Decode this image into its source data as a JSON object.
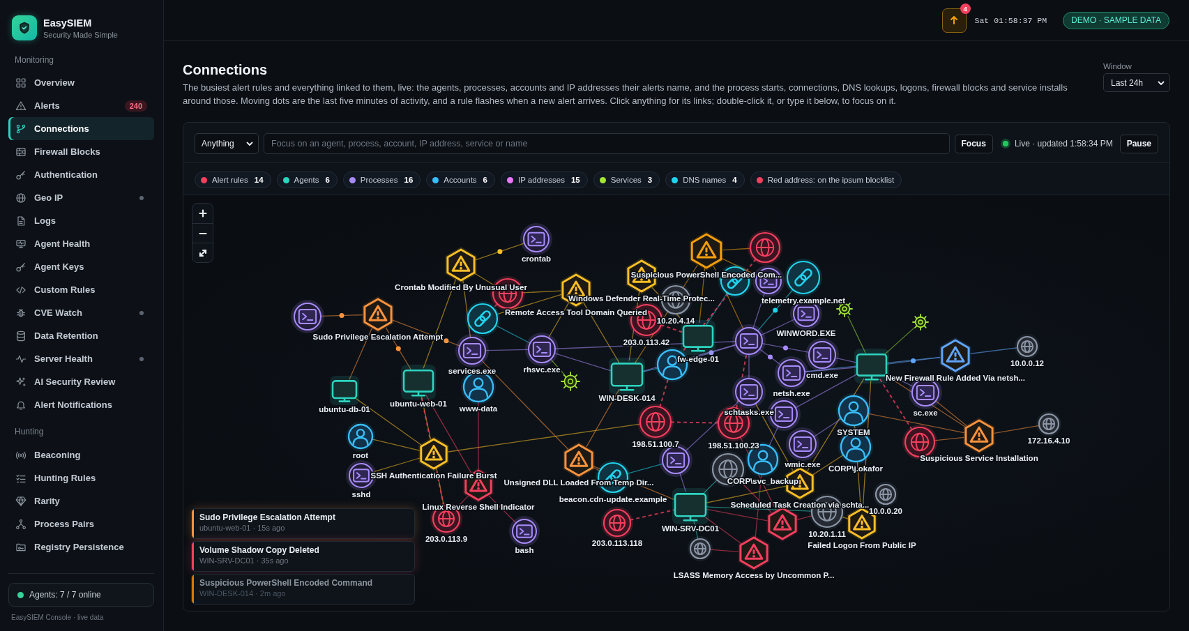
{
  "sidebar": {
    "brand": "EasySIEM",
    "tagline": "Security Made Simple",
    "sections": [
      {
        "title": "Monitoring",
        "items": [
          {
            "label": "Overview",
            "selected": false,
            "dot": false
          },
          {
            "label": "Alerts",
            "selected": false,
            "dot": false,
            "badge": "240"
          },
          {
            "label": "Connections",
            "selected": true,
            "dot": false
          },
          {
            "label": "Firewall Blocks",
            "selected": false,
            "dot": false
          },
          {
            "label": "Authentication",
            "selected": false,
            "dot": false
          },
          {
            "label": "Geo IP",
            "selected": false,
            "dot": true
          },
          {
            "label": "Logs",
            "selected": false,
            "dot": false
          },
          {
            "label": "Agent Health",
            "selected": false,
            "dot": false
          },
          {
            "label": "Agent Keys",
            "selected": false,
            "dot": false
          },
          {
            "label": "Custom Rules",
            "selected": false,
            "dot": false
          },
          {
            "label": "CVE Watch",
            "selected": false,
            "dot": true
          },
          {
            "label": "Data Retention",
            "selected": false,
            "dot": false
          },
          {
            "label": "Server Health",
            "selected": false,
            "dot": true
          },
          {
            "label": "AI Security Review",
            "selected": false,
            "dot": false
          },
          {
            "label": "Alert Notifications",
            "selected": false,
            "dot": false
          }
        ]
      },
      {
        "title": "Hunting",
        "items": [
          {
            "label": "Beaconing",
            "selected": false,
            "dot": false
          },
          {
            "label": "Hunting Rules",
            "selected": false,
            "dot": false
          },
          {
            "label": "Rarity",
            "selected": false,
            "dot": false
          },
          {
            "label": "Process Pairs",
            "selected": false,
            "dot": false
          },
          {
            "label": "Registry Persistence",
            "selected": false,
            "dot": false
          }
        ]
      }
    ],
    "agents_status": {
      "text": "Agents: 7 / 7 online",
      "online": true
    },
    "footer": "EasySIEM Console · live data"
  },
  "topbar": {
    "update_count": "4",
    "clock": "Sat 01:58:37 PM",
    "mode_badge": "DEMO · SAMPLE DATA"
  },
  "page": {
    "title": "Connections",
    "description": "The busiest alert rules and everything linked to them, live: the agents, processes, accounts and IP addresses their alerts name, and the process starts, connections, DNS lookups, logons, firewall blocks and service installs around those. Moving dots are the last five minutes of activity, and a rule flashes when a new alert arrives. Click anything for its links; double-click it, or type it below, to focus on it.",
    "window": {
      "label": "Window",
      "value": "Last 24h"
    }
  },
  "toolbar": {
    "filter": "Anything",
    "search": {
      "placeholder": "Focus on an agent, process, account, IP address, service or name"
    },
    "focus_button": "Focus",
    "live": {
      "on": true,
      "text": "Live · updated 1:58:34 PM"
    },
    "pause_button": "Pause"
  },
  "legend": [
    {
      "label": "Alert rules",
      "count": "14",
      "color": "#f43f5e"
    },
    {
      "label": "Agents",
      "count": "6",
      "color": "#2dd4bf"
    },
    {
      "label": "Processes",
      "count": "16",
      "color": "#a78bfa"
    },
    {
      "label": "Accounts",
      "count": "6",
      "color": "#38bdf8"
    },
    {
      "label": "IP addresses",
      "count": "15",
      "color": "#e879f9"
    },
    {
      "label": "Services",
      "count": "3",
      "color": "#a3e635"
    },
    {
      "label": "DNS names",
      "count": "4",
      "color": "#22d3ee"
    },
    {
      "label": "Red address: on the ipsum blocklist",
      "color": "#f43f5e"
    }
  ],
  "graph": {
    "nodes": [
      {
        "kind": "process",
        "label": "crontab"
      },
      {
        "kind": "ip",
        "blocklisted": true
      },
      {
        "kind": "alert",
        "label": "Crontab Modified By Unusual User",
        "color": "#fbbf24"
      },
      {
        "kind": "alert",
        "label": "Suspicious PowerShell Encoded Com...",
        "color": "#f59e0b"
      },
      {
        "kind": "dns"
      },
      {
        "kind": "process"
      },
      {
        "kind": "ip",
        "blocklisted": true
      },
      {
        "kind": "alert",
        "label": "Windows Defender Real-Time Protec...",
        "color": "#fbbf24"
      },
      {
        "kind": "dns",
        "label": "telemetry.example.net"
      },
      {
        "kind": "process"
      },
      {
        "kind": "dns"
      },
      {
        "kind": "alert",
        "label": "Remote Access Tool Domain Queried",
        "color": "#fbbf24"
      },
      {
        "kind": "ip",
        "label": "10.20.4.14",
        "blocklisted": false
      },
      {
        "kind": "service"
      },
      {
        "kind": "service"
      },
      {
        "kind": "alert",
        "label": "Sudo Privilege Escalation Attempt",
        "color": "#fb923c"
      },
      {
        "kind": "ip",
        "label": "203.0.113.42",
        "blocklisted": true
      },
      {
        "kind": "process"
      },
      {
        "kind": "process",
        "label": "WINWORD.EXE"
      },
      {
        "kind": "process",
        "label": "services.exe"
      },
      {
        "kind": "process",
        "label": "rhsvc.exe"
      },
      {
        "kind": "account"
      },
      {
        "kind": "agent",
        "label": "fw-edge-01"
      },
      {
        "kind": "agent"
      },
      {
        "kind": "ip",
        "label": "10.0.0.12",
        "blocklisted": false
      },
      {
        "kind": "service"
      },
      {
        "kind": "process",
        "label": "cmd.exe"
      },
      {
        "kind": "alert",
        "label": "New Firewall Rule Added Via netsh...",
        "color": "#60a5fa"
      },
      {
        "kind": "agent",
        "label": "ubuntu-web-01"
      },
      {
        "kind": "agent",
        "label": "WIN-DESK-014"
      },
      {
        "kind": "process",
        "label": "netsh.exe"
      },
      {
        "kind": "agent",
        "label": "ubuntu-db-01"
      },
      {
        "kind": "account",
        "label": "www-data"
      },
      {
        "kind": "process",
        "label": "schtasks.exe"
      },
      {
        "kind": "process"
      },
      {
        "kind": "process",
        "label": "sc.exe"
      },
      {
        "kind": "ip",
        "label": "198.51.100.7",
        "blocklisted": true
      },
      {
        "kind": "ip",
        "label": "198.51.100.23",
        "blocklisted": true
      },
      {
        "kind": "account",
        "label": "SYSTEM"
      },
      {
        "kind": "ip",
        "blocklisted": true
      },
      {
        "kind": "ip",
        "label": "172.16.4.10",
        "blocklisted": false
      },
      {
        "kind": "account",
        "label": "root"
      },
      {
        "kind": "process"
      },
      {
        "kind": "ip",
        "blocklisted": false
      },
      {
        "kind": "process",
        "label": "wmic.exe"
      },
      {
        "kind": "account",
        "label": "CORP\\j.okafor"
      },
      {
        "kind": "alert",
        "label": "Suspicious Service Installation",
        "color": "#fb923c"
      },
      {
        "kind": "alert",
        "label": "SSH Authentication Failure Burst",
        "color": "#fbbf24"
      },
      {
        "kind": "alert",
        "label": "Unsigned DLL Loaded From Temp Dir...",
        "color": "#fb923c"
      },
      {
        "kind": "account",
        "label": "CORP\\svc_backup"
      },
      {
        "kind": "process",
        "label": "sshd"
      },
      {
        "kind": "alert",
        "label": "Linux Reverse Shell Indicator",
        "color": "#f43f5e"
      },
      {
        "kind": "dns",
        "label": "beacon.cdn-update.example"
      },
      {
        "kind": "alert",
        "label": "Scheduled Task Creation via schta...",
        "color": "#fbbf24"
      },
      {
        "kind": "alert",
        "color": "#f43f5e"
      },
      {
        "kind": "ip",
        "label": "10.0.0.20",
        "blocklisted": false
      },
      {
        "kind": "ip",
        "label": "203.0.113.9",
        "blocklisted": true
      },
      {
        "kind": "ip",
        "label": "203.0.113.118",
        "blocklisted": true
      },
      {
        "kind": "agent",
        "label": "WIN-SRV-DC01"
      },
      {
        "kind": "ip",
        "label": "10.20.1.11",
        "blocklisted": false
      },
      {
        "kind": "process",
        "label": "bash"
      },
      {
        "kind": "ip",
        "blocklisted": false
      },
      {
        "kind": "alert",
        "label": "Failed Logon From Public IP",
        "color": "#fbbf24"
      },
      {
        "kind": "alert",
        "label": "LSASS Memory Access by Uncommon P...",
        "color": "#f43f5e"
      }
    ]
  },
  "toasts": [
    {
      "title": "Sudo Privilege Escalation Attempt",
      "detail": "ubuntu-web-01 · 15s ago",
      "color": "#fb923c",
      "fading": false
    },
    {
      "title": "Volume Shadow Copy Deleted",
      "detail": "WIN-SRV-DC01 · 35s ago",
      "color": "#f43f5e",
      "fading": false
    },
    {
      "title": "Suspicious PowerShell Encoded Command",
      "detail": "WIN-DESK-014 · 2m ago",
      "color": "#d97706",
      "fading": true
    }
  ]
}
